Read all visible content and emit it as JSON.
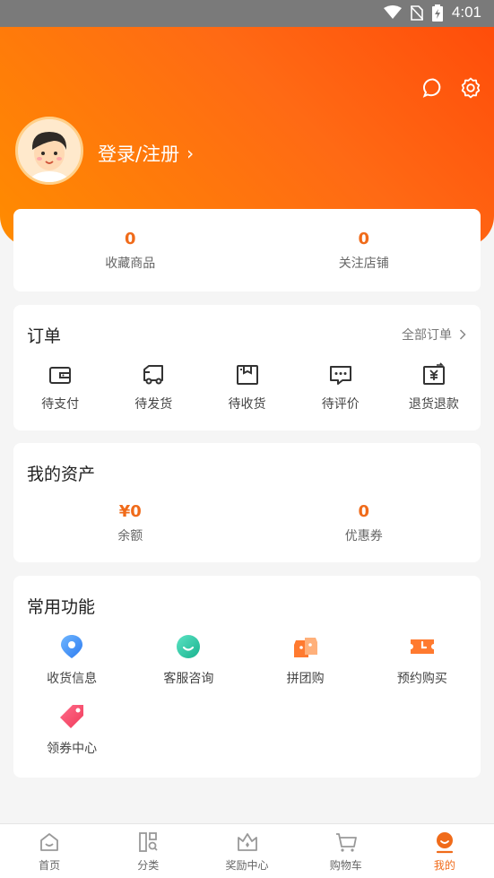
{
  "status_bar": {
    "time": "4:01"
  },
  "profile": {
    "login_label": "登录/注册",
    "login_chevron": "›"
  },
  "stats": [
    {
      "value": "0",
      "label": "收藏商品"
    },
    {
      "value": "0",
      "label": "关注店铺"
    }
  ],
  "orders": {
    "title": "订单",
    "all_label": "全部订单",
    "items": [
      {
        "label": "待支付",
        "icon": "wallet-icon"
      },
      {
        "label": "待发货",
        "icon": "truck-icon"
      },
      {
        "label": "待收货",
        "icon": "package-icon"
      },
      {
        "label": "待评价",
        "icon": "comment-icon"
      },
      {
        "label": "退货退款",
        "icon": "refund-icon"
      }
    ]
  },
  "assets": {
    "title": "我的资产",
    "items": [
      {
        "value": "¥0",
        "label": "余额"
      },
      {
        "value": "0",
        "label": "优惠券"
      }
    ]
  },
  "functions": {
    "title": "常用功能",
    "items": [
      {
        "label": "收货信息",
        "icon": "location-pin-icon"
      },
      {
        "label": "客服咨询",
        "icon": "customer-service-icon"
      },
      {
        "label": "拼团购",
        "icon": "group-buy-icon"
      },
      {
        "label": "预约购买",
        "icon": "reservation-ticket-icon"
      },
      {
        "label": "领券中心",
        "icon": "coupon-tag-icon"
      }
    ]
  },
  "tabbar": {
    "items": [
      {
        "label": "首页",
        "icon": "home-icon",
        "active": false
      },
      {
        "label": "分类",
        "icon": "category-icon",
        "active": false
      },
      {
        "label": "奖励中心",
        "icon": "reward-crown-icon",
        "active": false
      },
      {
        "label": "购物车",
        "icon": "cart-icon",
        "active": false
      },
      {
        "label": "我的",
        "icon": "profile-icon",
        "active": true
      }
    ]
  },
  "colors": {
    "accent": "#f06b1a",
    "header_start": "#ff8c00",
    "header_end": "#ff4d0a"
  }
}
